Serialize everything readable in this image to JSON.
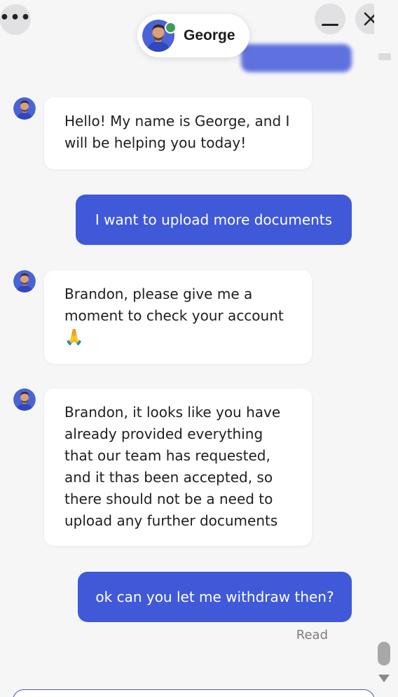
{
  "header": {
    "agent_name": "George",
    "more_icon": "more-horizontal-icon",
    "minimize_icon": "minimize-icon",
    "close_icon": "close-icon",
    "online_status_color": "#3f9d5b"
  },
  "colors": {
    "accent": "#3f59d9",
    "background": "#f6f6f7",
    "agent_bubble": "#ffffff"
  },
  "messages": [
    {
      "sender": "agent",
      "text": "Hello! My name is George, and I will be helping you today!"
    },
    {
      "sender": "user",
      "text": "I want to upload more documents"
    },
    {
      "sender": "agent",
      "text": "Brandon, please give me a moment to check your account",
      "emoji": "🙏"
    },
    {
      "sender": "agent",
      "text": "Brandon, it looks like you have already provided everything that our team has requested, and it thas been accepted, so there should not be a need to upload any further documents"
    },
    {
      "sender": "user",
      "text": "ok can you let me withdraw then?"
    }
  ],
  "read_receipt": "Read"
}
